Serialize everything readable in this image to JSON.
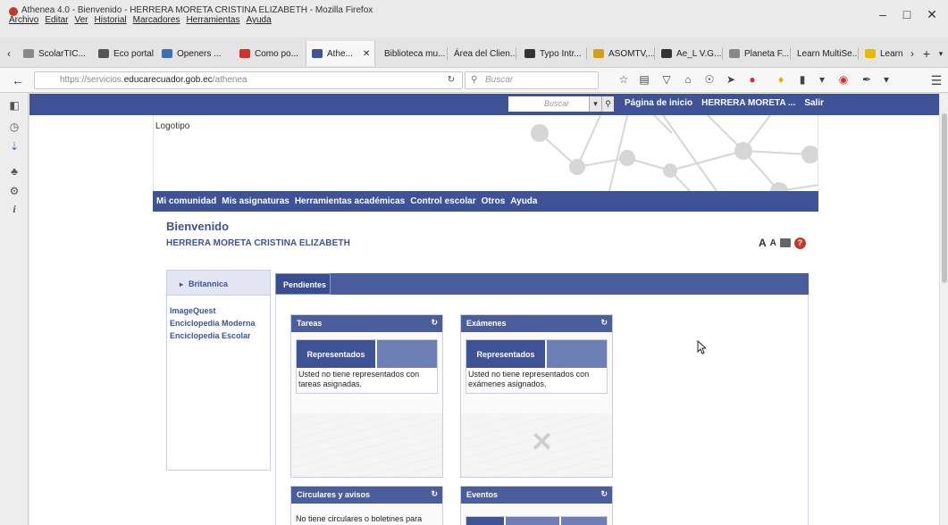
{
  "window": {
    "title": "Athenea 4.0 - Bienvenido - HERRERA MORETA CRISTINA ELIZABETH - Mozilla Firefox",
    "menu": [
      "Archivo",
      "Editar",
      "Ver",
      "Historial",
      "Marcadores",
      "Herramientas",
      "Ayuda"
    ]
  },
  "tabs": [
    {
      "label": "ScolarTIC...",
      "color": "#888"
    },
    {
      "label": "Eco portal",
      "color": "#555"
    },
    {
      "label": "Openers ...",
      "color": "#3d6fb8"
    },
    {
      "label": "Como po...",
      "color": "#d32f2f"
    },
    {
      "label": "Athe...",
      "color": "#3f5295"
    },
    {
      "label": "Biblioteca mu...",
      "color": ""
    },
    {
      "label": "Área del Clien...",
      "color": ""
    },
    {
      "label": "Typo Intr...",
      "color": "#333"
    },
    {
      "label": "ASOMTV,...",
      "color": "#d4a017"
    },
    {
      "label": "Ae_L V.G...",
      "color": "#333"
    },
    {
      "label": "Planeta F...",
      "color": "#888"
    },
    {
      "label": "Learn MultiSe...",
      "color": ""
    },
    {
      "label": "Learn",
      "color": "#e6b800"
    }
  ],
  "navigation": {
    "url_prefix": "https://servicios.",
    "url_domain": "educarecuador.gob.ec",
    "url_path": "/athenea",
    "search_placeholder": "Buscar"
  },
  "site": {
    "search_placeholder": "Buscar",
    "top_links": [
      "Página de inicio",
      "HERRERA MORETA ...",
      "Salir"
    ],
    "logo_text": "Logotipo",
    "main_nav": [
      "Mi comunidad",
      "Mis asignaturas",
      "Herramientas académicas",
      "Control escolar",
      "Otros",
      "Ayuda"
    ],
    "welcome": "Bienvenido",
    "user_name": "HERRERA MORETA CRISTINA ELIZABETH",
    "font_larger": "A",
    "font_smaller": "A",
    "help_glyph": "?"
  },
  "resources": {
    "header": "Britannica",
    "items": [
      "ImageQuest",
      "Enciclopedia Moderna",
      "Enciclopedia Escolar"
    ]
  },
  "pending": {
    "tab_label": "Pendientes",
    "cards": [
      {
        "title": "Tareas",
        "inner_tab": "Representados",
        "text": "Usted no tiene representados con tareas asignadas."
      },
      {
        "title": "Exámenes",
        "inner_tab": "Representados",
        "text": "Usted no tiene representados con exámenes asignados."
      },
      {
        "title": "Circulares y avisos",
        "text": "No tiene circulares o boletines para"
      },
      {
        "title": "Eventos"
      }
    ]
  },
  "colors": {
    "primary": "#3f5295",
    "secondary": "#6e7fb6",
    "panel_border": "#c9cde0",
    "help": "#c0392b"
  }
}
